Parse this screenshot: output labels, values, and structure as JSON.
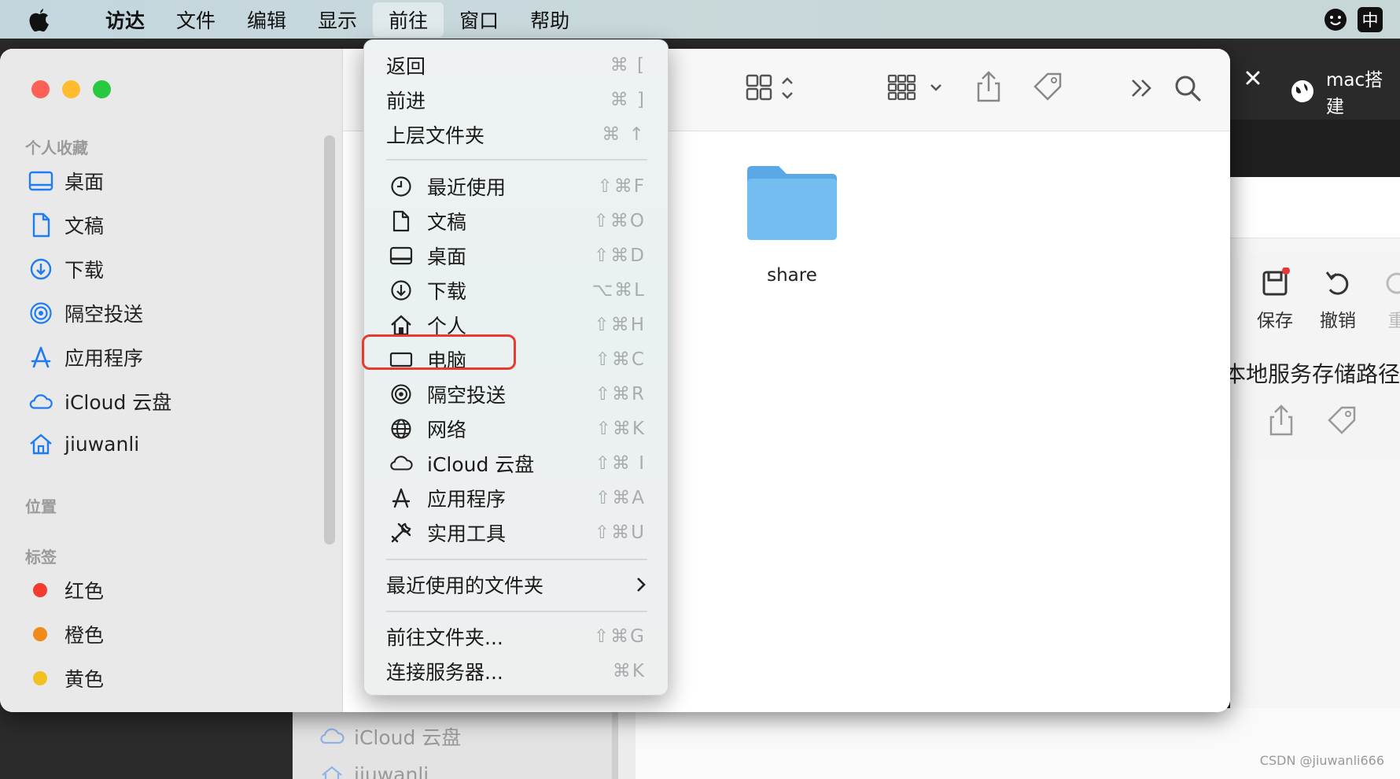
{
  "menubar": {
    "app_name": "访达",
    "menus": [
      "文件",
      "编辑",
      "显示",
      "前往",
      "窗口",
      "帮助"
    ],
    "active_menu": "前往",
    "input_method": "中"
  },
  "sidebar": {
    "favorites_header": "个人收藏",
    "favorites": [
      {
        "label": "桌面",
        "icon": "desktop-icon"
      },
      {
        "label": "文稿",
        "icon": "document-icon"
      },
      {
        "label": "下载",
        "icon": "download-icon"
      },
      {
        "label": "隔空投送",
        "icon": "airdrop-icon"
      },
      {
        "label": "应用程序",
        "icon": "applications-icon"
      },
      {
        "label": "iCloud 云盘",
        "icon": "icloud-icon"
      },
      {
        "label": "jiuwanli",
        "icon": "home-icon"
      }
    ],
    "locations_header": "位置",
    "tags_header": "标签",
    "tags": [
      {
        "label": "红色",
        "color": "#f33b30"
      },
      {
        "label": "橙色",
        "color": "#f08a18"
      },
      {
        "label": "黄色",
        "color": "#f3c021"
      }
    ],
    "accent_color": "#1f7cf2"
  },
  "content": {
    "folder_name": "share",
    "folder_color": "#6db8ef"
  },
  "go_menu": {
    "items": [
      {
        "label": "返回",
        "shortcut": "⌘ [",
        "icon": ""
      },
      {
        "label": "前进",
        "shortcut": "⌘ ]",
        "icon": ""
      },
      {
        "label": "上层文件夹",
        "shortcut": "⌘ ↑",
        "icon": ""
      },
      {
        "label": "最近使用",
        "shortcut": "⇧⌘F",
        "icon": "clock-icon"
      },
      {
        "label": "文稿",
        "shortcut": "⇧⌘O",
        "icon": "document-icon"
      },
      {
        "label": "桌面",
        "shortcut": "⇧⌘D",
        "icon": "desktop-icon"
      },
      {
        "label": "下载",
        "shortcut": "⌥⌘L",
        "icon": "download-icon"
      },
      {
        "label": "个人",
        "shortcut": "⇧⌘H",
        "icon": "home-icon"
      },
      {
        "label": "电脑",
        "shortcut": "⇧⌘C",
        "icon": "computer-icon"
      },
      {
        "label": "隔空投送",
        "shortcut": "⇧⌘R",
        "icon": "airdrop-icon"
      },
      {
        "label": "网络",
        "shortcut": "⇧⌘K",
        "icon": "network-icon"
      },
      {
        "label": "iCloud 云盘",
        "shortcut": "⇧⌘ I",
        "icon": "icloud-icon"
      },
      {
        "label": "应用程序",
        "shortcut": "⇧⌘A",
        "icon": "applications-icon"
      },
      {
        "label": "实用工具",
        "shortcut": "⇧⌘U",
        "icon": "utilities-icon"
      },
      {
        "label": "最近使用的文件夹",
        "shortcut": "",
        "icon": "chevron-right-icon"
      },
      {
        "label": "前往文件夹...",
        "shortcut": "⇧⌘G",
        "icon": ""
      },
      {
        "label": "连接服务器...",
        "shortcut": "⌘K",
        "icon": ""
      }
    ],
    "highlighted_item": "电脑",
    "highlight_color": "#e63b2e"
  },
  "browser": {
    "tab_title": "mac搭建",
    "tools": [
      "保存",
      "撤销",
      "重"
    ],
    "heading": "本地服务存储路径"
  },
  "background_finder": {
    "item": "iCloud 云盘",
    "item2": "jiuwanli"
  },
  "watermark": "CSDN @jiuwanli666"
}
